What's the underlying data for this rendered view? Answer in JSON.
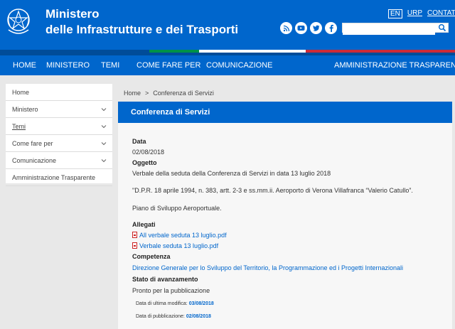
{
  "header": {
    "title_line1": "Ministero",
    "title_line2": "delle Infrastrutture e dei Trasporti",
    "lang": "EN",
    "urp": "URP",
    "contatti": "CONTATTI",
    "search_placeholder": "",
    "social_icons": [
      "rss-icon",
      "youtube-icon",
      "twitter-icon",
      "facebook-icon"
    ]
  },
  "nav": {
    "items": [
      "HOME",
      "MINISTERO",
      "TEMI",
      "COME FARE PER",
      "COMUNICAZIONE",
      "AMMINISTRAZIONE TRASPARENTE"
    ]
  },
  "sidebar": {
    "items": [
      {
        "label": "Home",
        "chevron": false
      },
      {
        "label": "Ministero",
        "chevron": true
      },
      {
        "label": "Temi",
        "chevron": true
      },
      {
        "label": "Come fare per",
        "chevron": true
      },
      {
        "label": "Comunicazione",
        "chevron": true
      },
      {
        "label": "Amministrazione Trasparente",
        "chevron": false
      }
    ]
  },
  "breadcrumb": {
    "home": "Home",
    "sep": ">",
    "current": "Conferenza di Servizi"
  },
  "main": {
    "title": "Conferenza di Servizi",
    "data_label": "Data",
    "data_value": "02/08/2018",
    "oggetto_label": "Oggetto",
    "oggetto_line1": "Verbale della seduta della Conferenza di Servizi in data 13 luglio 2018",
    "oggetto_line2": "\"D.P.R. 18 aprile 1994, n. 383, artt. 2-3 e ss.mm.ii. Aeroporto di Verona Villafranca “Valerio Catullo”.",
    "oggetto_line3": "Piano di Sviluppo Aeroportuale.",
    "allegati_label": "Allegati",
    "allegato1": "All verbale seduta 13 luglio.pdf",
    "allegato2": "Verbale seduta 13 luglio.pdf",
    "competenza_label": "Competenza",
    "competenza_value": "Direzione Generale per lo Sviluppo del Territorio, la Programmazione ed i Progetti Internazionali",
    "stato_label": "Stato di avanzamento",
    "stato_value": "Pronto per la pubblicazione",
    "ultima_modifica_label": "Data di ultima modifica:",
    "ultima_modifica_value": "03/08/2018",
    "pubblicazione_label": "Data di pubblicazione:",
    "pubblicazione_value": "02/08/2018"
  },
  "colors": {
    "brand_blue": "#0066cc",
    "green": "#009246",
    "red": "#ce2b37",
    "page_bg": "#e8e8e8"
  }
}
